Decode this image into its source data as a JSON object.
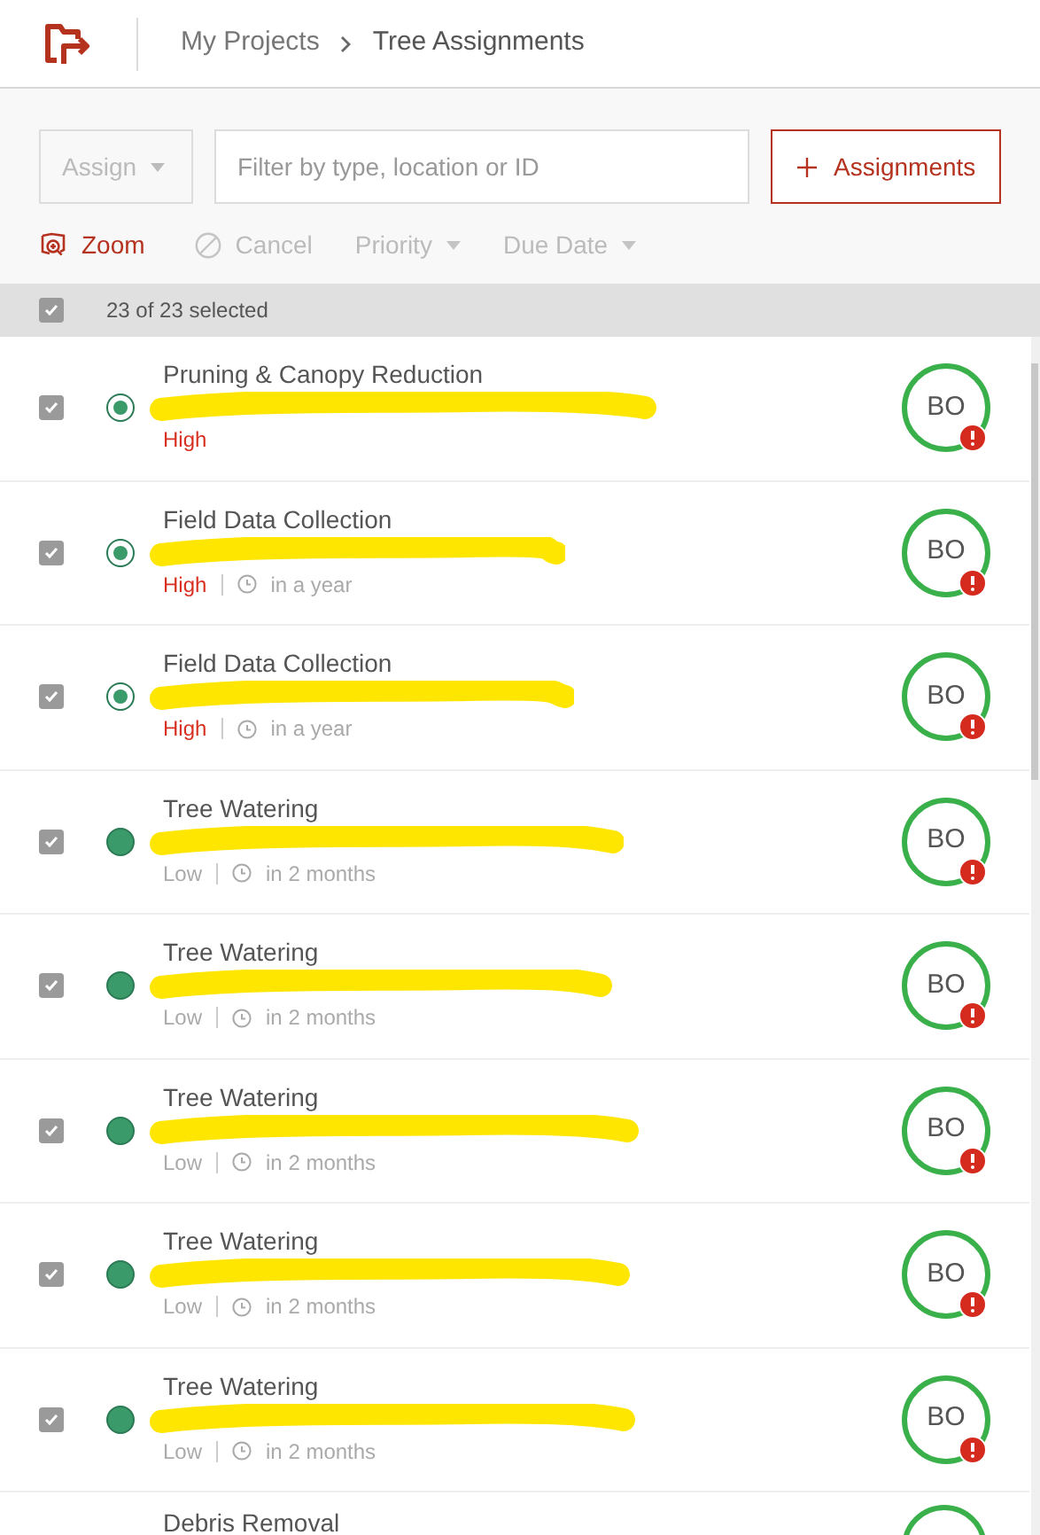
{
  "breadcrumb": [
    {
      "label": "My Projects"
    },
    {
      "label": "Tree Assignments"
    }
  ],
  "toolbar": {
    "assign": {
      "label": "Assign",
      "disabled": true
    },
    "search": {
      "placeholder": "Filter by type, location or ID"
    },
    "add_button": "Assignments",
    "actions": [
      {
        "label": "Zoom",
        "kind": "zoom",
        "disabled": false
      },
      {
        "label": "Cancel",
        "kind": "cancel",
        "disabled": true
      },
      {
        "label": "Priority",
        "kind": "dropdown",
        "disabled": true
      },
      {
        "label": "Due Date",
        "kind": "dropdown",
        "disabled": true
      }
    ]
  },
  "selection": {
    "checked": true,
    "text": "23 of 23 selected"
  },
  "assignments": [
    {
      "title": "Pruning & Canopy Reduction",
      "checked": true,
      "kind": "assigned",
      "priority": "High",
      "high": true,
      "worker": "BO",
      "alert": true
    },
    {
      "title": "Field Data Collection",
      "checked": true,
      "kind": "assigned",
      "priority": "High",
      "high": true,
      "due": "in a year",
      "worker": "BO",
      "alert": true
    },
    {
      "title": "Field Data Collection",
      "checked": true,
      "kind": "assigned",
      "priority": "High",
      "high": true,
      "due": "in a year",
      "worker": "BO",
      "alert": true
    },
    {
      "title": "Tree Watering",
      "checked": true,
      "kind": "filled",
      "priority": "Low",
      "high": false,
      "due": "in 2 months",
      "worker": "BO",
      "alert": true
    },
    {
      "title": "Tree Watering",
      "checked": true,
      "kind": "filled",
      "priority": "Low",
      "high": false,
      "due": "in 2 months",
      "worker": "BO",
      "alert": true
    },
    {
      "title": "Tree Watering",
      "checked": true,
      "kind": "filled",
      "priority": "Low",
      "high": false,
      "due": "in 2 months",
      "worker": "BO",
      "alert": true
    },
    {
      "title": "Tree Watering",
      "checked": true,
      "kind": "filled",
      "priority": "Low",
      "high": false,
      "due": "in 2 months",
      "worker": "BO",
      "alert": true
    },
    {
      "title": "Tree Watering",
      "checked": true,
      "kind": "filled",
      "priority": "Low",
      "high": false,
      "due": "in 2 months",
      "worker": "BO",
      "alert": true
    },
    {
      "title": "Debris Removal"
    }
  ]
}
